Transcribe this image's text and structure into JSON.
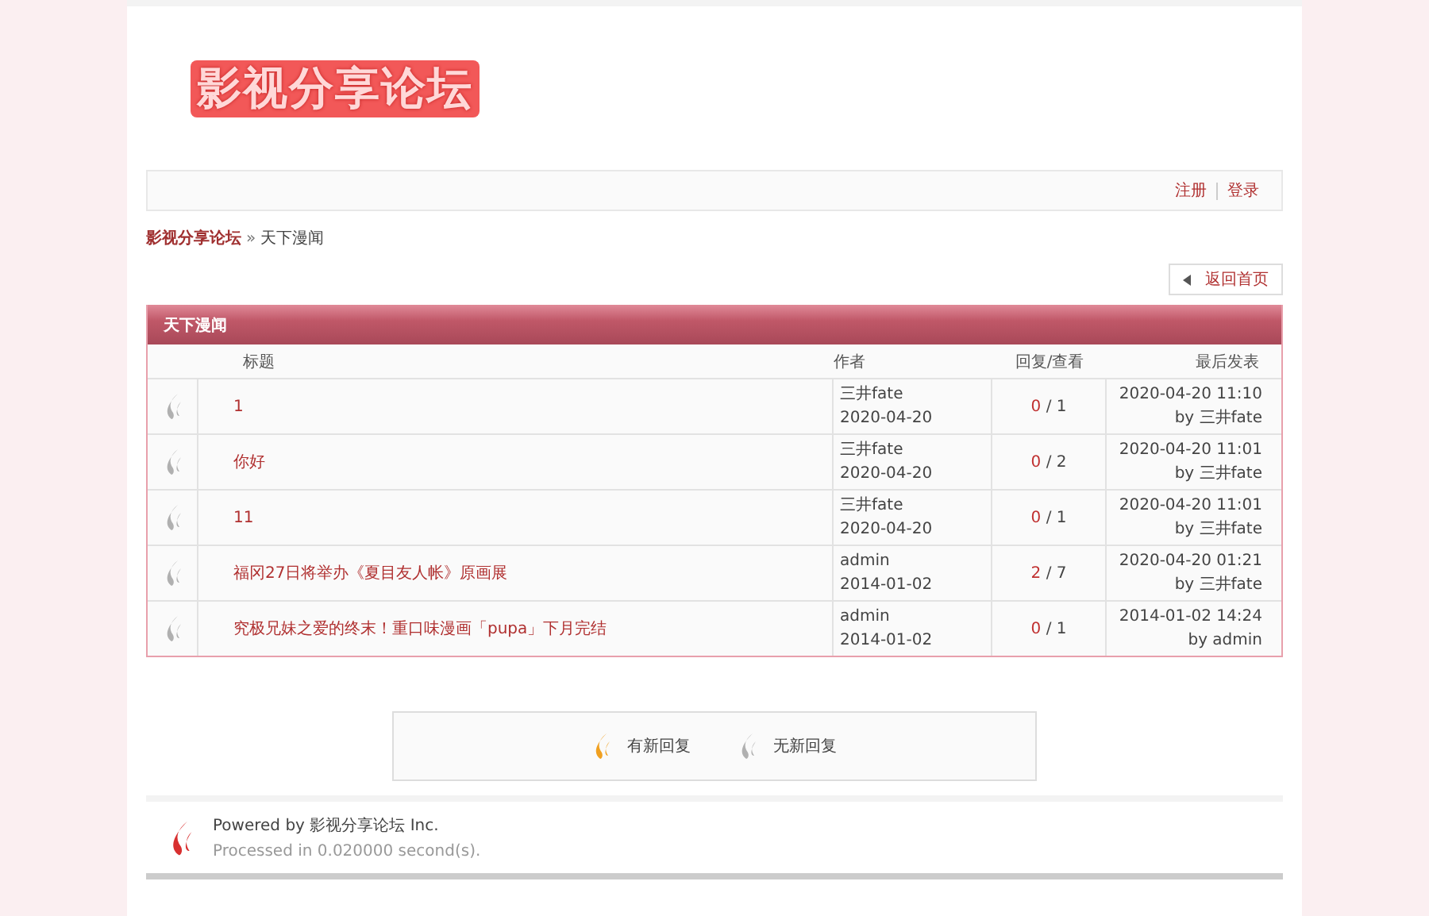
{
  "logo": {
    "text": "影视分享论坛"
  },
  "nav": {
    "links": [
      {
        "label": "注册"
      },
      {
        "label": "登录"
      }
    ]
  },
  "breadcrumb": {
    "home": "影视分享论坛",
    "separator": "»",
    "current": "天下漫闻"
  },
  "back_button": {
    "label": "返回首页"
  },
  "forum": {
    "title": "天下漫闻",
    "columns": [
      "标题",
      "作者",
      "回复/查看",
      "最后发表"
    ],
    "rows": [
      {
        "title": "1",
        "author": "三井fate",
        "date": "2020-04-20",
        "replies": "0",
        "views": "/ 1",
        "last_time": "2020-04-20 11:10",
        "last_by": "by 三井fate",
        "new_reply": false
      },
      {
        "title": "你好",
        "author": "三井fate",
        "date": "2020-04-20",
        "replies": "0",
        "views": "/ 2",
        "last_time": "2020-04-20 11:01",
        "last_by": "by 三井fate",
        "new_reply": false
      },
      {
        "title": "11",
        "author": "三井fate",
        "date": "2020-04-20",
        "replies": "0",
        "views": "/ 1",
        "last_time": "2020-04-20 11:01",
        "last_by": "by 三井fate",
        "new_reply": false
      },
      {
        "title": "福冈27日将举办《夏目友人帐》原画展",
        "author": "admin",
        "date": "2014-01-02",
        "replies": "2",
        "views": "/ 7",
        "last_time": "2020-04-20 01:21",
        "last_by": "by 三井fate",
        "new_reply": false
      },
      {
        "title": "究极兄妹之爱的终末！重口味漫画「pupa」下月完结",
        "author": "admin",
        "date": "2014-01-02",
        "replies": "0",
        "views": "/ 1",
        "last_time": "2014-01-02 14:24",
        "last_by": "by admin",
        "new_reply": false
      }
    ]
  },
  "legend": [
    {
      "label": "有新回复",
      "new_reply": true
    },
    {
      "label": "无新回复",
      "new_reply": false
    }
  ],
  "footer": {
    "powered": "Powered by 影视分享论坛 Inc.",
    "processed": "Processed in 0.020000 second(s)."
  }
}
